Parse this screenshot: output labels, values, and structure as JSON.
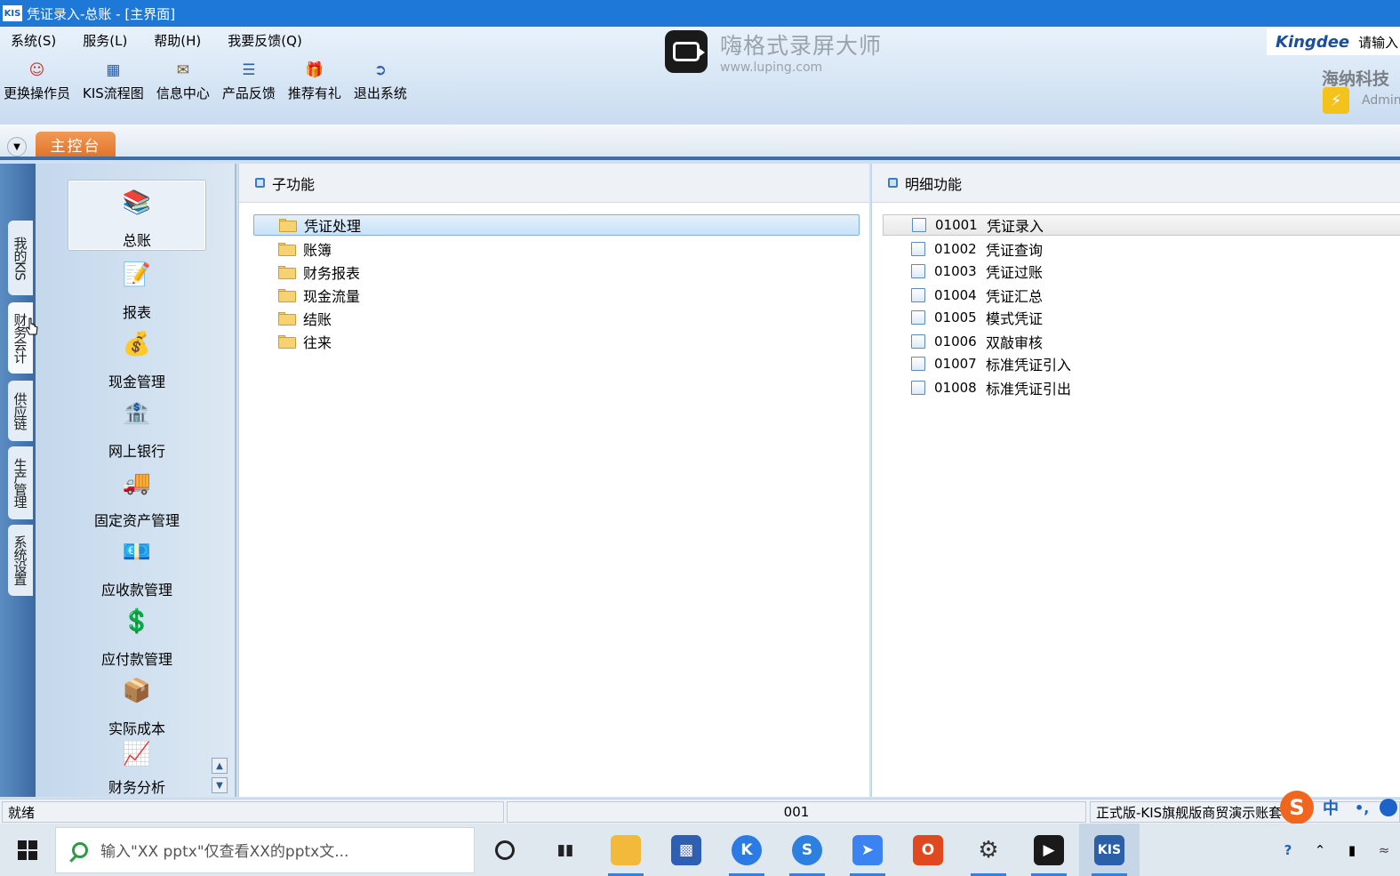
{
  "window": {
    "app_icon": "KIS",
    "title": "凭证录入-总账 - [主界面]"
  },
  "menubar": {
    "items": [
      "系统(S)",
      "服务(L)",
      "帮助(H)",
      "我要反馈(Q)"
    ]
  },
  "toolbar": {
    "buttons": [
      {
        "label": "更换操作员",
        "icon": "change-operator-icon"
      },
      {
        "label": "KIS流程图",
        "icon": "flowchart-icon"
      },
      {
        "label": "信息中心",
        "icon": "message-center-icon"
      },
      {
        "label": "产品反馈",
        "icon": "feedback-icon"
      },
      {
        "label": "推荐有礼",
        "icon": "gift-icon"
      },
      {
        "label": "退出系统",
        "icon": "exit-icon"
      }
    ]
  },
  "overlay": {
    "recorder_title": "嗨格式录屏大师",
    "recorder_url": "www.luping.com"
  },
  "brand": {
    "logo": "Kingdee",
    "hint": "请输入"
  },
  "company": "海纳科技",
  "user": "Admin",
  "tabs": {
    "main_tab": "主控台"
  },
  "side_tabs": [
    {
      "label": "我的KIS"
    },
    {
      "label": "财务会计",
      "active": true
    },
    {
      "label": "供应链"
    },
    {
      "label": "生产管理"
    },
    {
      "label": "系统设置"
    }
  ],
  "modules": [
    {
      "label": "总账",
      "icon": "general-ledger-icon",
      "selected": true
    },
    {
      "label": "报表",
      "icon": "report-icon"
    },
    {
      "label": "现金管理",
      "icon": "cash-management-icon"
    },
    {
      "label": "网上银行",
      "icon": "online-bank-icon"
    },
    {
      "label": "固定资产管理",
      "icon": "fixed-assets-icon"
    },
    {
      "label": "应收款管理",
      "icon": "receivables-icon"
    },
    {
      "label": "应付款管理",
      "icon": "payables-icon"
    },
    {
      "label": "实际成本",
      "icon": "actual-cost-icon"
    },
    {
      "label": "财务分析",
      "icon": "financial-analysis-icon"
    }
  ],
  "sub_panel": {
    "title": "子功能",
    "items": [
      {
        "label": "凭证处理",
        "selected": true
      },
      {
        "label": "账簿"
      },
      {
        "label": "财务报表"
      },
      {
        "label": "现金流量"
      },
      {
        "label": "结账"
      },
      {
        "label": "往来"
      }
    ]
  },
  "detail_panel": {
    "title": "明细功能",
    "items": [
      {
        "code": "01001",
        "label": "凭证录入",
        "selected": true
      },
      {
        "code": "01002",
        "label": "凭证查询"
      },
      {
        "code": "01003",
        "label": "凭证过账"
      },
      {
        "code": "01004",
        "label": "凭证汇总"
      },
      {
        "code": "01005",
        "label": "模式凭证"
      },
      {
        "code": "01006",
        "label": "双敲审核"
      },
      {
        "code": "01007",
        "label": "标准凭证引入"
      },
      {
        "code": "01008",
        "label": "标准凭证引出"
      }
    ]
  },
  "statusbar": {
    "status": "就绪",
    "account_code": "001",
    "edition": "正式版-KIS旗舰版商贸演示账套"
  },
  "taskbar": {
    "search_placeholder": "输入\"XX pptx\"仅查看XX的pptx文...",
    "apps": [
      {
        "name": "cortana-icon"
      },
      {
        "name": "task-view-icon"
      },
      {
        "name": "file-explorer-icon",
        "running": true
      },
      {
        "name": "network-icon"
      },
      {
        "name": "kingdee-k-icon",
        "running": true
      },
      {
        "name": "sogou-browser-icon",
        "running": true
      },
      {
        "name": "feishu-icon",
        "running": true
      },
      {
        "name": "office-icon"
      },
      {
        "name": "settings-icon",
        "running": true
      },
      {
        "name": "screen-recorder-icon",
        "running": true
      },
      {
        "name": "kis-icon",
        "running": true,
        "label": "KIS"
      }
    ]
  },
  "ime": {
    "logo": "S",
    "lang": "中",
    "punct": "•,"
  },
  "colors": {
    "titlebar": "#1e78d7",
    "tab_orange": "#e2742c",
    "selection_blue": "#c8e2f7"
  }
}
